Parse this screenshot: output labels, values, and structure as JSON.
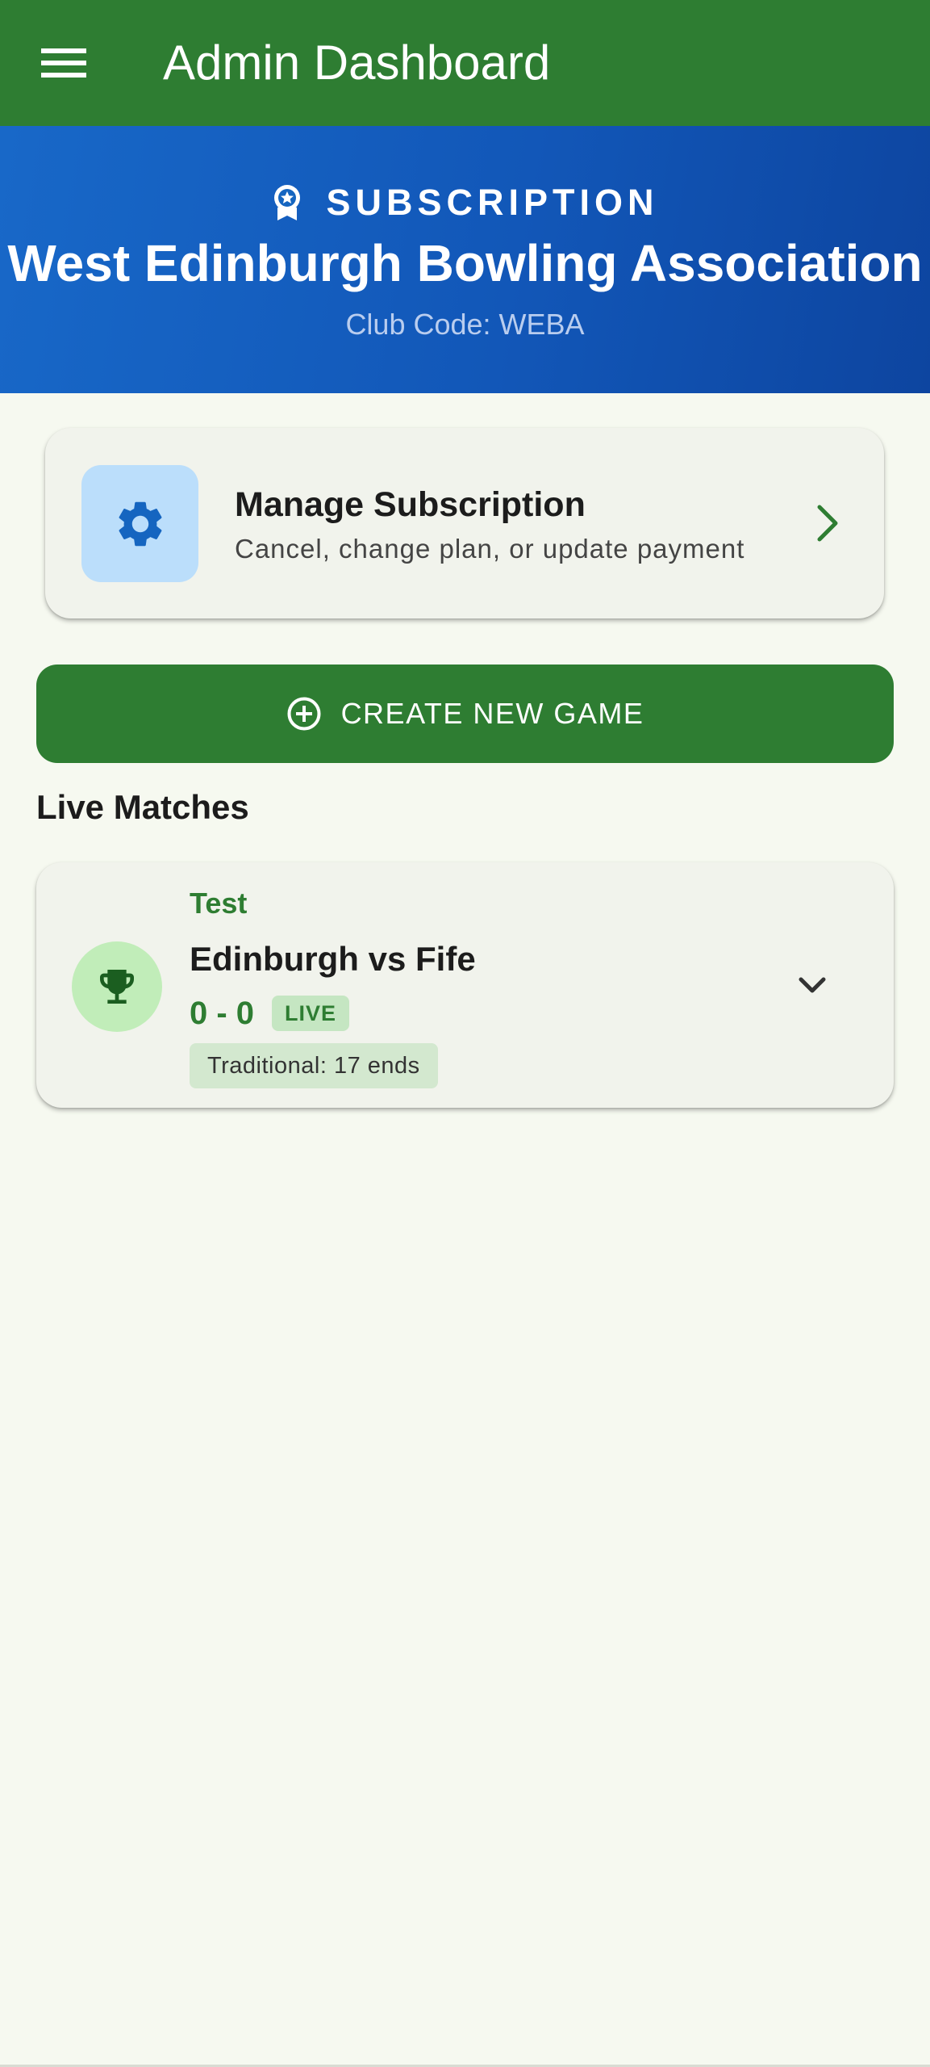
{
  "appbar": {
    "title": "Admin Dashboard",
    "menu_icon": "hamburger-menu-icon"
  },
  "banner": {
    "icon": "award-badge-icon",
    "label": "SUBSCRIPTION",
    "club_name": "West Edinburgh Bowling Association",
    "club_code": "Club Code: WEBA"
  },
  "manage_subscription": {
    "icon": "gear-icon",
    "title": "Manage Subscription",
    "subtitle": "Cancel, change plan, or update payment",
    "chevron_icon": "chevron-right-icon"
  },
  "create_game": {
    "icon": "add-circle-icon",
    "label": "CREATE NEW GAME"
  },
  "live_matches": {
    "title": "Live Matches",
    "items": [
      {
        "icon": "trophy-icon",
        "tag": "Test",
        "teams": "Edinburgh vs Fife",
        "score": "0 - 0",
        "status": "LIVE",
        "format": "Traditional: 17 ends",
        "expand_icon": "chevron-down-icon"
      }
    ]
  },
  "colors": {
    "primary_green": "#2e7d32",
    "banner_blue": "#1565c0",
    "background": "#f6f9f0",
    "card": "#f1f3ec",
    "gear_tile": "#bbdefb",
    "trophy_circle": "#c1edb9"
  }
}
